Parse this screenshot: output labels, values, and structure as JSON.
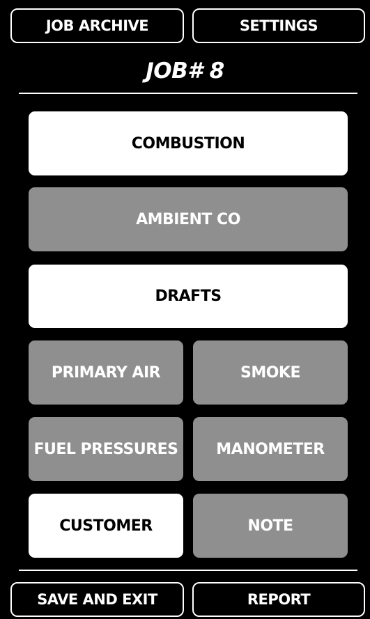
{
  "header": {
    "job_archive_label": "JOB ARCHIVE",
    "settings_label": "SETTINGS",
    "job_title": "JOB# 8"
  },
  "menu": {
    "combustion": "COMBUSTION",
    "ambient_co": "AMBIENT CO",
    "drafts": "DRAFTS",
    "primary_air": "PRIMARY AIR",
    "smoke": "SMOKE",
    "fuel_pressures": "FUEL PRESSURES",
    "manometer": "MANOMETER",
    "customer": "CUSTOMER",
    "note": "NOTE"
  },
  "footer": {
    "save_and_exit_label": "SAVE AND EXIT",
    "report_label": "REPORT"
  },
  "colors": {
    "background": "#000000",
    "active_tile": "#ffffff",
    "inactive_tile": "#8f8f8f",
    "text_light": "#ffffff",
    "text_dark": "#000000"
  }
}
